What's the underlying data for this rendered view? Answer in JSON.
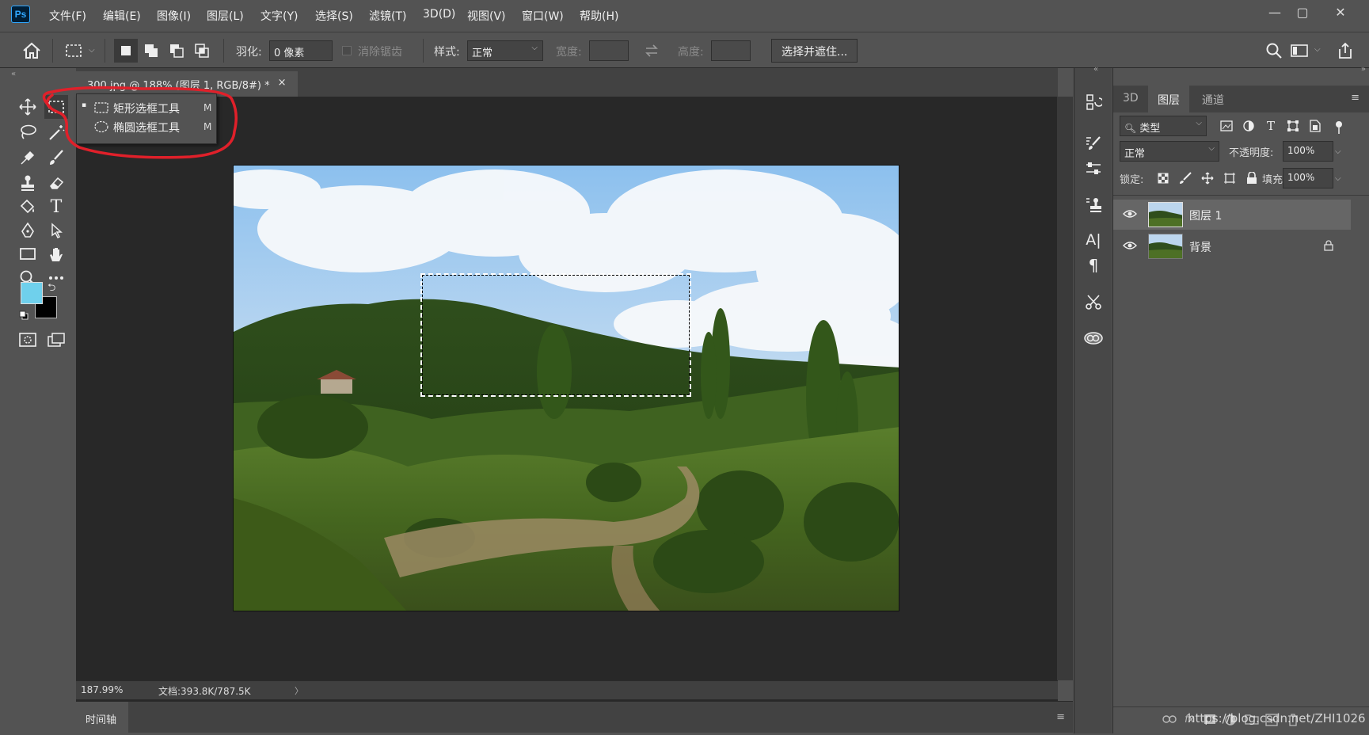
{
  "app": {
    "logo": "Ps"
  },
  "menu": [
    "文件(F)",
    "编辑(E)",
    "图像(I)",
    "图层(L)",
    "文字(Y)",
    "选择(S)",
    "滤镜(T)",
    "3D(D)",
    "视图(V)",
    "窗口(W)",
    "帮助(H)"
  ],
  "window_controls": {
    "minimize": "—",
    "restore": "▢",
    "close": "✕"
  },
  "options": {
    "feather_label": "羽化:",
    "feather_value": "0 像素",
    "antialias_label": "消除锯齿",
    "style_label": "样式:",
    "style_value": "正常",
    "width_label": "宽度:",
    "height_label": "高度:",
    "select_mask_button": "选择并遮住..."
  },
  "document": {
    "tab_title": "300.jpg @ 188% (图层 1, RGB/8#) *",
    "tab_close": "×",
    "zoom": "187.99%",
    "doc_info": "文档:393.8K/787.5K",
    "status_arrow": "〉"
  },
  "timeline": {
    "label": "时间轴"
  },
  "flyout": {
    "items": [
      {
        "label": "矩形选框工具",
        "shortcut": "M",
        "active": true
      },
      {
        "label": "椭圆选框工具",
        "shortcut": "M",
        "active": false
      }
    ]
  },
  "colors": {
    "foreground": "#6fd0ec",
    "background": "#000000",
    "annotation": "#e0202a",
    "accent": "#31a8ff"
  },
  "panels": {
    "tabs": [
      "3D",
      "图层",
      "通道"
    ],
    "active_tab": "图层",
    "filter_label": "类型",
    "blend_mode": "正常",
    "opacity_label": "不透明度:",
    "opacity_value": "100%",
    "lock_label": "锁定:",
    "fill_label": "填充:",
    "fill_value": "100%",
    "layers": [
      {
        "name": "图层 1",
        "selected": true,
        "locked": false
      },
      {
        "name": "背景",
        "selected": false,
        "locked": true
      }
    ]
  },
  "watermark": "https://blog.csdn.net/ZHI1026"
}
